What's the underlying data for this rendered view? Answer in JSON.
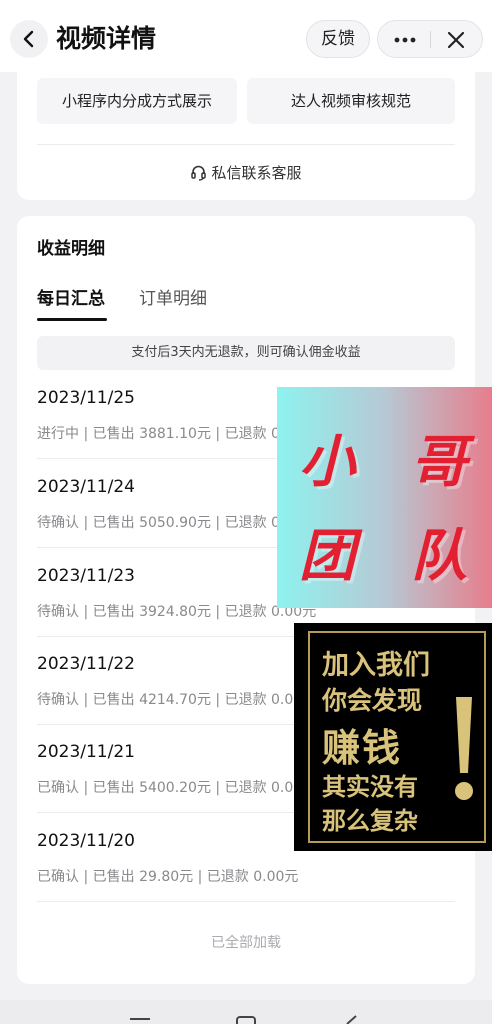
{
  "header": {
    "title": "视频详情",
    "feedback_label": "反馈"
  },
  "quick_links": {
    "items": [
      "小程序内分成方式展示",
      "达人视频审核规范"
    ],
    "customer_service": "私信联系客服"
  },
  "earnings": {
    "title": "收益明细",
    "tabs": [
      {
        "label": "每日汇总",
        "active": true
      },
      {
        "label": "订单明细",
        "active": false
      }
    ],
    "notice": "支付后3天内无退款，则可确认佣金收益",
    "days": [
      {
        "date": "2023/11/25",
        "detail": "进行中 | 已售出 3881.10元 | 已退款 0.00元"
      },
      {
        "date": "2023/11/24",
        "detail": "待确认 | 已售出 5050.90元 | 已退款 0.00元"
      },
      {
        "date": "2023/11/23",
        "detail": "待确认 | 已售出 3924.80元 | 已退款 0.00元"
      },
      {
        "date": "2023/11/22",
        "detail": "待确认 | 已售出 4214.70元 | 已退款 0.00元"
      },
      {
        "date": "2023/11/21",
        "detail": "已确认 | 已售出 5400.20元 | 已退款 0.00元"
      },
      {
        "date": "2023/11/20",
        "detail": "已确认 | 已售出 29.80元 | 已退款 0.00元"
      }
    ],
    "end_text": "已全部加载"
  },
  "overlay_watermark": {
    "chars": [
      "小",
      "哥",
      "团",
      "队"
    ]
  },
  "overlay_promo": {
    "lines": [
      "加入我们",
      "你会发现",
      "赚钱",
      "其实没有",
      "那么复杂"
    ]
  },
  "colors": {
    "accent_text": "#111111",
    "muted_text": "#8a8a8e",
    "watermark_red": "#e32031",
    "gold": "#d9c27a"
  },
  "icons": [
    "back-arrow-icon",
    "more-dots-icon",
    "close-icon",
    "headset-icon",
    "exclamation-icon"
  ]
}
